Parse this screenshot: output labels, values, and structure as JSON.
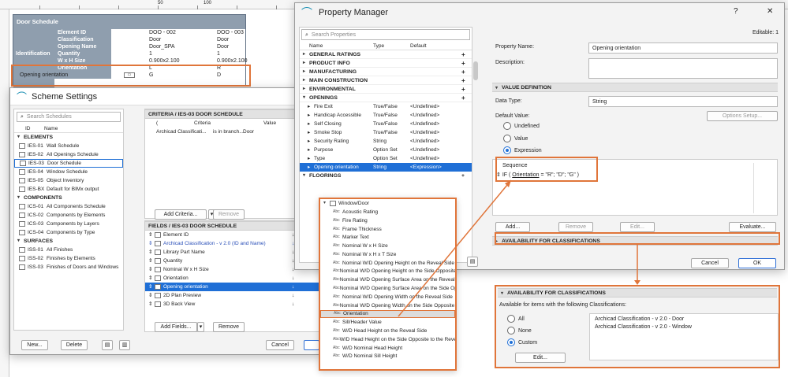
{
  "ruler": {
    "marks": [
      "50",
      "100"
    ]
  },
  "schedule": {
    "title": "Door Schedule",
    "group": "Identification",
    "rows": [
      {
        "label": "Element ID",
        "a": "DOO - 002",
        "b": "DOO - 003"
      },
      {
        "label": "Classification",
        "a": "Door",
        "b": "Door"
      },
      {
        "label": "Opening Name",
        "a": "Door_SPA",
        "b": "Door"
      },
      {
        "label": "Quantity",
        "a": "1",
        "b": "1"
      },
      {
        "label": "W x H Size",
        "a": "0.900x2.100",
        "b": "0.900x2.100"
      },
      {
        "label": "Orientation",
        "a": "L",
        "b": "R"
      },
      {
        "label": "Opening orientation",
        "a": "G",
        "b": "D"
      }
    ]
  },
  "scheme": {
    "title": "Scheme Settings",
    "search_placeholder": "Search Schedules",
    "col_id": "ID",
    "col_name": "Name",
    "groups": [
      {
        "name": "ELEMENTS",
        "items": [
          {
            "id": "IES-01",
            "name": "Wall Schedule"
          },
          {
            "id": "IES-02",
            "name": "All Openings Schedule"
          },
          {
            "id": "IES-03",
            "name": "Door Schedule"
          },
          {
            "id": "IES-04",
            "name": "Window Schedule"
          },
          {
            "id": "IES-05",
            "name": "Object Inventory"
          },
          {
            "id": "IES-BX",
            "name": "Default for BIMx output"
          }
        ]
      },
      {
        "name": "COMPONENTS",
        "items": [
          {
            "id": "ICS-01",
            "name": "All Components Schedule"
          },
          {
            "id": "ICS-02",
            "name": "Components by Elements"
          },
          {
            "id": "ICS-03",
            "name": "Components by Layers"
          },
          {
            "id": "ICS-04",
            "name": "Components by Type"
          }
        ]
      },
      {
        "name": "SURFACES",
        "items": [
          {
            "id": "ISS-01",
            "name": "All Finishes"
          },
          {
            "id": "ISS-02",
            "name": "Finishes by Elements"
          },
          {
            "id": "ISS-03",
            "name": "Finishes of Doors and Windows"
          }
        ]
      }
    ],
    "criteria_title": "CRITERIA / IES-03 DOOR SCHEDULE",
    "criteria_cols": {
      "paren": "(",
      "criteria": "Criteria",
      "value": "Value"
    },
    "criteria_row": {
      "criteria": "Archicad Classificati...",
      "op": "is in branch...",
      "value": "Door"
    },
    "add_criteria": "Add Criteria...",
    "remove": "Remove",
    "fields_title": "FIELDS / IES-03 DOOR SCHEDULE",
    "fields": [
      "Element ID",
      "Archicad Classification - v 2.0 (ID and Name)",
      "Library Part Name",
      "Quantity",
      "Nominal W x H Size",
      "Orientation",
      "Opening orientation",
      "2D Plan Preview",
      "3D Back View"
    ],
    "add_fields": "Add Fields...",
    "remove2": "Remove",
    "new": "New...",
    "delete": "Delete",
    "cancel": "Cancel"
  },
  "pm": {
    "title": "Property Manager",
    "help": "?",
    "close": "✕",
    "search_placeholder": "Search Properties",
    "cols": {
      "name": "Name",
      "type": "Type",
      "default": "Default"
    },
    "groups": [
      "GENERAL RATINGS",
      "PRODUCT INFO",
      "MANUFACTURING",
      "MAIN CONSTRUCTION",
      "ENVIRONMENTAL",
      "OPENINGS"
    ],
    "openings": [
      {
        "name": "Fire Exit",
        "type": "True/False",
        "default": "<Undefined>"
      },
      {
        "name": "Handicap Accessible",
        "type": "True/False",
        "default": "<Undefined>"
      },
      {
        "name": "Self Closing",
        "type": "True/False",
        "default": "<Undefined>"
      },
      {
        "name": "Smoke Stop",
        "type": "True/False",
        "default": "<Undefined>"
      },
      {
        "name": "Security Rating",
        "type": "String",
        "default": "<Undefined>"
      },
      {
        "name": "Purpose",
        "type": "Option Set",
        "default": "<Undefined>"
      },
      {
        "name": "Type",
        "type": "Option Set",
        "default": "<Undefined>"
      },
      {
        "name": "Opening orientation",
        "type": "String",
        "default": "<Expression>"
      }
    ],
    "floorings": "FLOORINGS",
    "editable": "Editable: 1",
    "property_name_label": "Property Name:",
    "property_name_value": "Opening orientation",
    "description_label": "Description:",
    "value_definition": "VALUE DEFINITION",
    "data_type_label": "Data Type:",
    "data_type_value": "String",
    "default_value_label": "Default Value:",
    "options_setup": "Options Setup...",
    "radio_undefined": "Undefined",
    "radio_value": "Value",
    "radio_expression": "Expression",
    "sequence_label": "Sequence",
    "expr_prefix": "IF ( ",
    "expr_link": "Orientation",
    "expr_suffix": " = \"R\"; \"D\"; \"G\" )",
    "add": "Add...",
    "remove": "Remove",
    "edit": "Edit...",
    "evaluate": "Evaluate...",
    "availability": "AVAILABILITY FOR CLASSIFICATIONS",
    "cancel": "Cancel",
    "ok": "OK"
  },
  "popup": {
    "header": "Window/Door",
    "items": [
      "Acoustic Rating",
      "Fire Rating",
      "Frame Thickness",
      "Marker Text",
      "Nominal W x H Size",
      "Nominal W x H x T Size",
      "Nominal W/D Opening Height on the Reveal Side",
      "Nominal W/D Opening Height on the Side Opposite to the Reveal Side",
      "Nominal W/D Opening Surface Area on the Reveal Side",
      "Nominal W/D Opening Surface Area on the Side Opposite to the Reveal Side",
      "Nominal W/D Opening Width on the Reveal Side",
      "Nominal W/D Opening Width on the Side Opposite to the Reveal Side",
      "Orientation",
      "Sill/Header Value",
      "W/D Head Height on the Reveal Side",
      "W/D Head Height on the Side Opposite to the Reveal Side",
      "W/D Nominal Head Height",
      "W/D Nominal Sill Height"
    ]
  },
  "avail": {
    "title": "AVAILABILITY FOR CLASSIFICATIONS",
    "desc": "Available for items with the following Classifications:",
    "all": "All",
    "none": "None",
    "custom": "Custom",
    "edit": "Edit...",
    "class1": "Archicad Classification - v 2.0 - Door",
    "class2": "Archicad Classification - v 2.0 - Window"
  },
  "colors": {
    "highlight": "#e0753a",
    "selection": "#1f6fd6"
  }
}
